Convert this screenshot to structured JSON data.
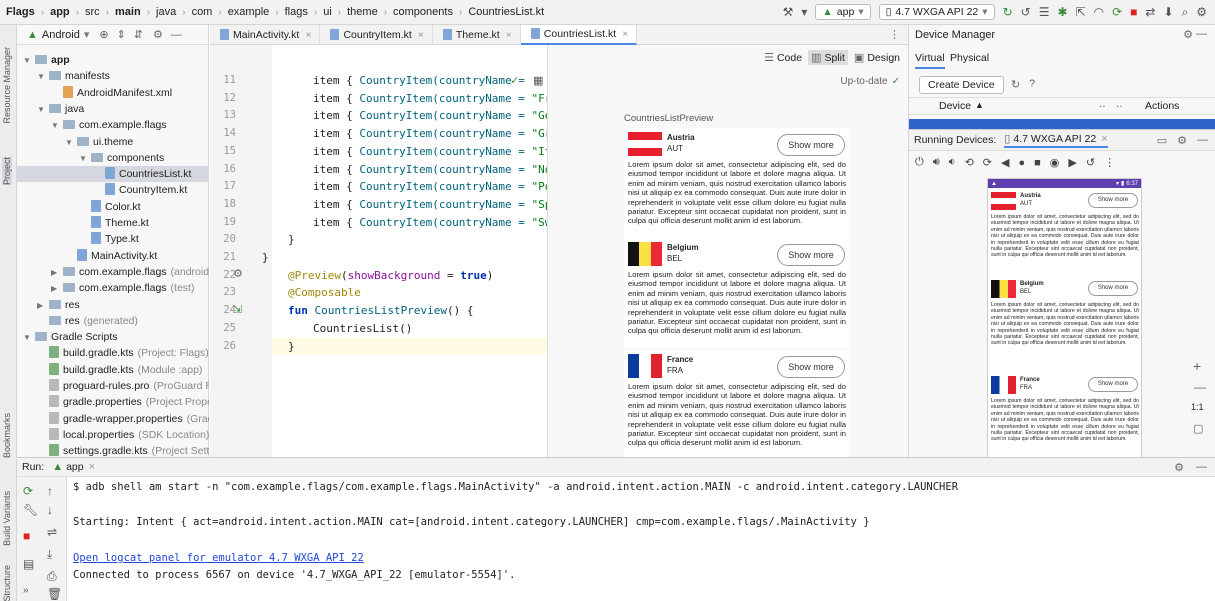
{
  "breadcrumb": [
    "Flags",
    "app",
    "src",
    "main",
    "java",
    "com",
    "example",
    "flags",
    "ui",
    "theme",
    "components",
    "CountriesList.kt"
  ],
  "toolbar": {
    "run_config": "app",
    "device": "4.7 WXGA API 22"
  },
  "colors": {
    "accent": "#4a86e8",
    "emulator_bar": "#5f3fb0",
    "selection": "#d5d8de"
  },
  "project": {
    "view": "Android",
    "tree": [
      {
        "indent": 0,
        "label": "app",
        "icon": "folder",
        "bold": true
      },
      {
        "indent": 1,
        "label": "manifests",
        "icon": "folder"
      },
      {
        "indent": 2,
        "label": "AndroidManifest.xml",
        "icon": "file-xml"
      },
      {
        "indent": 1,
        "label": "java",
        "icon": "folder"
      },
      {
        "indent": 2,
        "label": "com.example.flags",
        "icon": "folder"
      },
      {
        "indent": 3,
        "label": "ui.theme",
        "icon": "folder"
      },
      {
        "indent": 4,
        "label": "components",
        "icon": "folder"
      },
      {
        "indent": 5,
        "label": "CountriesList.kt",
        "icon": "file-kt",
        "selected": true
      },
      {
        "indent": 5,
        "label": "CountryItem.kt",
        "icon": "file-kt"
      },
      {
        "indent": 4,
        "label": "Color.kt",
        "icon": "file-kt"
      },
      {
        "indent": 4,
        "label": "Theme.kt",
        "icon": "file-kt"
      },
      {
        "indent": 4,
        "label": "Type.kt",
        "icon": "file-kt"
      },
      {
        "indent": 3,
        "label": "MainActivity.kt",
        "icon": "file-kt"
      },
      {
        "indent": 2,
        "label": "com.example.flags",
        "icon": "folder",
        "hint": "(androidTe"
      },
      {
        "indent": 2,
        "label": "com.example.flags",
        "icon": "folder",
        "hint": "(test)"
      },
      {
        "indent": 1,
        "label": "res",
        "icon": "folder"
      },
      {
        "indent": 1,
        "label": "res",
        "icon": "folder",
        "hint": "(generated)"
      },
      {
        "indent": 0,
        "label": "Gradle Scripts",
        "icon": "folder"
      },
      {
        "indent": 1,
        "label": "build.gradle.kts",
        "icon": "file-gradle",
        "hint": "(Project: Flags)"
      },
      {
        "indent": 1,
        "label": "build.gradle.kts",
        "icon": "file-gradle",
        "hint": "(Module :app)"
      },
      {
        "indent": 1,
        "label": "proguard-rules.pro",
        "icon": "file",
        "hint": "(ProGuard Rul"
      },
      {
        "indent": 1,
        "label": "gradle.properties",
        "icon": "file",
        "hint": "(Project Propert"
      },
      {
        "indent": 1,
        "label": "gradle-wrapper.properties",
        "icon": "file",
        "hint": "(Gradl"
      },
      {
        "indent": 1,
        "label": "local.properties",
        "icon": "file",
        "hint": "(SDK Location)"
      },
      {
        "indent": 1,
        "label": "settings.gradle.kts",
        "icon": "file-gradle",
        "hint": "(Project Setting"
      }
    ]
  },
  "editor_tabs": [
    {
      "label": "MainActivity.kt"
    },
    {
      "label": "CountryItem.kt"
    },
    {
      "label": "Theme.kt"
    },
    {
      "label": "CountriesList.kt",
      "active": true
    }
  ],
  "view_modes": {
    "code": "Code",
    "split": "Split",
    "design": "Design"
  },
  "preview": {
    "status": "Up-to-date",
    "title": "CountriesListPreview"
  },
  "code_lines": [
    {
      "n": "11",
      "prefix": "item { ",
      "call": "CountryItem(countryName = ",
      "arg": "",
      "suffix": ""
    },
    {
      "n": "12",
      "prefix": "item { ",
      "call": "CountryItem(countryName = ",
      "arg": "\"Fr",
      "suffix": ""
    },
    {
      "n": "13",
      "prefix": "item { ",
      "call": "CountryItem(countryName = ",
      "arg": "\"Ge",
      "suffix": ""
    },
    {
      "n": "14",
      "prefix": "item { ",
      "call": "CountryItem(countryName = ",
      "arg": "\"Gr",
      "suffix": ""
    },
    {
      "n": "15",
      "prefix": "item { ",
      "call": "CountryItem(countryName = ",
      "arg": "\"It",
      "suffix": ""
    },
    {
      "n": "16",
      "prefix": "item { ",
      "call": "CountryItem(countryName = ",
      "arg": "\"No",
      "suffix": ""
    },
    {
      "n": "17",
      "prefix": "item { ",
      "call": "CountryItem(countryName = ",
      "arg": "\"Po",
      "suffix": ""
    },
    {
      "n": "18",
      "prefix": "item { ",
      "call": "CountryItem(countryName = ",
      "arg": "\"Sp",
      "suffix": ""
    },
    {
      "n": "19",
      "prefix": "item { ",
      "call": "CountryItem(countryName = ",
      "arg": "\"Sw",
      "suffix": ""
    }
  ],
  "code_tail": {
    "l20": {
      "n": "20",
      "text": "}"
    },
    "l21": {
      "n": "21",
      "text": "}"
    },
    "l22": {
      "n": "22",
      "ann": "@Preview",
      "open": "(",
      "param": "showBackground",
      "eq": " = ",
      "val": "true",
      "close": ")"
    },
    "l23": {
      "n": "23",
      "ann": "@Composable"
    },
    "l24": {
      "n": "24",
      "kw": "fun ",
      "name": "CountriesListPreview",
      "rest": "() {"
    },
    "l25": {
      "n": "25",
      "text": "CountriesList()"
    },
    "l26": {
      "n": "26",
      "text": "}"
    }
  },
  "countries": [
    {
      "name": "Austria",
      "code": "AUT",
      "flag": "austria"
    },
    {
      "name": "Belgium",
      "code": "BEL",
      "flag": "belgium"
    },
    {
      "name": "France",
      "code": "FRA",
      "flag": "france"
    }
  ],
  "show_more_label": "Show more",
  "lorem": "Lorem ipsum dolor sit amet, consectetur adipiscing elit, sed do eiusmod tempor incididunt ut labore et dolore magna aliqua. Ut enim ad minim veniam, quis nostrud exercitation ullamco laboris nisi ut aliquip ex ea commodo consequat. Duis aute irure dolor in reprehenderit in voluptate velit esse cillum dolore eu fugiat nulla pariatur. Excepteur sint occaecat cupidatat non proident, sunt in culpa qui officia deserunt mollit anim id est laborum.",
  "device_manager": {
    "title": "Device Manager",
    "tabs": [
      "Virtual",
      "Physical"
    ],
    "create_button": "Create Device",
    "col_device": "Device",
    "col_actions": "Actions",
    "running_label": "Running Devices:",
    "running_device": "4.7 WXGA API 22",
    "emulator_time": "6:37",
    "zoom_ratio": "1:1"
  },
  "run_panel": {
    "label": "Run:",
    "config": "app",
    "lines": [
      "$ adb shell am start -n \"com.example.flags/com.example.flags.MainActivity\" -a android.intent.action.MAIN -c android.intent.category.LAUNCHER",
      "Starting: Intent { act=android.intent.action.MAIN cat=[android.intent.category.LAUNCHER] cmp=com.example.flags/.MainActivity }",
      "Open logcat panel for emulator 4.7 WXGA API 22",
      "Connected to process 6567 on device '4.7_WXGA_API_22 [emulator-5554]'."
    ]
  },
  "side_labels": {
    "resource_manager": "Resource Manager",
    "project": "Project",
    "bookmarks": "Bookmarks",
    "build_variants": "Build Variants",
    "structure": "Structure"
  }
}
